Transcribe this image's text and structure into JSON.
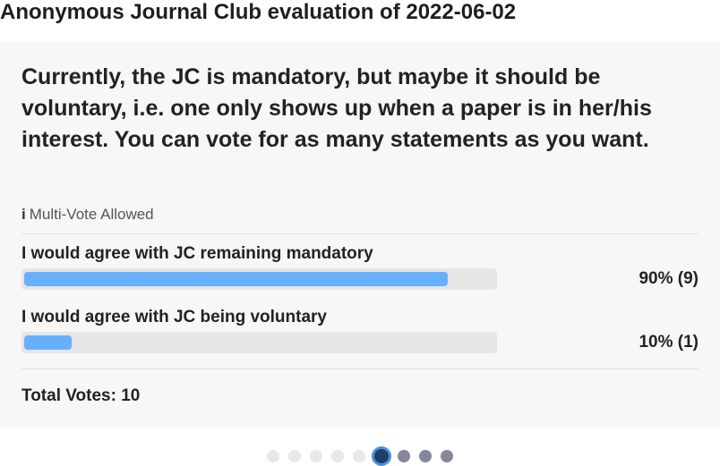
{
  "page": {
    "title": "Anonymous Journal Club evaluation of 2022-06-02"
  },
  "poll": {
    "question": "Currently, the JC is mandatory, but maybe it should be voluntary, i.e. one only shows up when a paper is in her/his interest. You can vote for as many statements as you want.",
    "info_icon": "i",
    "multi_vote_label": "Multi-Vote Allowed",
    "options": [
      {
        "label": "I would agree with JC remaining mandatory",
        "result": "90% (9)",
        "fraction": 0.9
      },
      {
        "label": "I would agree with JC being voluntary",
        "result": "10% (1)",
        "fraction": 0.1
      }
    ],
    "total_votes": "Total Votes: 10"
  },
  "pager": {
    "dots": [
      "inactive",
      "inactive",
      "inactive",
      "inactive",
      "inactive",
      "current",
      "upcoming",
      "upcoming",
      "upcoming"
    ]
  },
  "colors": {
    "bar_fill": "#66b0ff",
    "bar_track": "#e6e6e6",
    "card_background": "#f8f7f6"
  }
}
